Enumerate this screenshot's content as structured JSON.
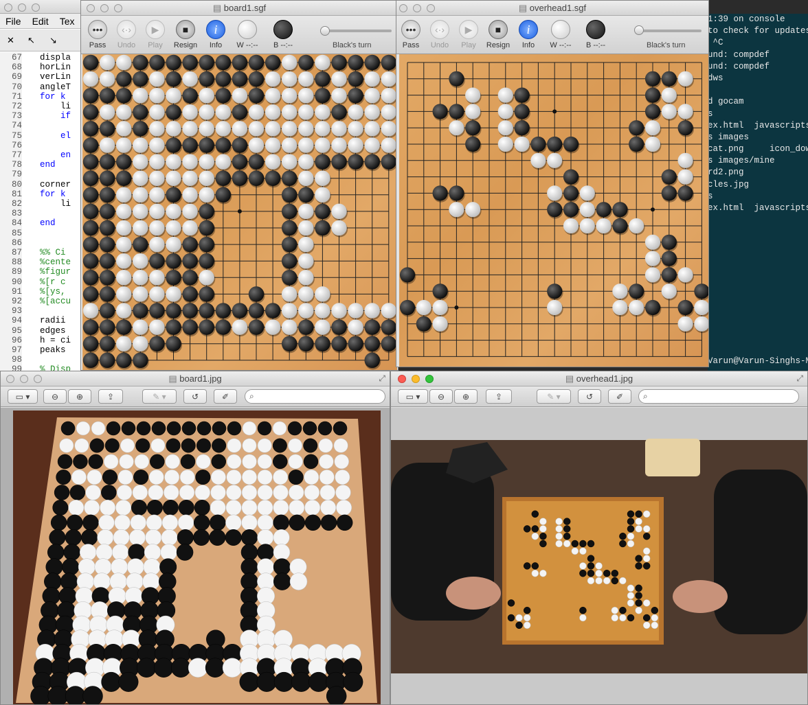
{
  "editor": {
    "menu": [
      "File",
      "Edit",
      "Tex"
    ],
    "lines": [
      {
        "n": "67",
        "t": "displa",
        "c": ""
      },
      {
        "n": "68",
        "t": "horLin",
        "c": ""
      },
      {
        "n": "69",
        "t": "verLin",
        "c": ""
      },
      {
        "n": "70",
        "t": "angleT",
        "c": ""
      },
      {
        "n": "71",
        "t": "for k",
        "c": "kw"
      },
      {
        "n": "72",
        "t": "    li",
        "c": ""
      },
      {
        "n": "73",
        "t": "    if",
        "c": "kw"
      },
      {
        "n": "74",
        "t": "",
        "c": ""
      },
      {
        "n": "75",
        "t": "    el",
        "c": "kw"
      },
      {
        "n": "76",
        "t": "",
        "c": ""
      },
      {
        "n": "77",
        "t": "    en",
        "c": "kw"
      },
      {
        "n": "78",
        "t": "end",
        "c": "kw"
      },
      {
        "n": "79",
        "t": "",
        "c": ""
      },
      {
        "n": "80",
        "t": "corner",
        "c": ""
      },
      {
        "n": "81",
        "t": "for k",
        "c": "kw"
      },
      {
        "n": "82",
        "t": "    li",
        "c": ""
      },
      {
        "n": "83",
        "t": "",
        "c": ""
      },
      {
        "n": "84",
        "t": "end",
        "c": "kw"
      },
      {
        "n": "85",
        "t": "",
        "c": ""
      },
      {
        "n": "86",
        "t": "",
        "c": ""
      },
      {
        "n": "87",
        "t": "%% Ci",
        "c": "cm"
      },
      {
        "n": "88",
        "t": "%cente",
        "c": "cm"
      },
      {
        "n": "89",
        "t": "%figur",
        "c": "cm"
      },
      {
        "n": "90",
        "t": "%[r c",
        "c": "cm"
      },
      {
        "n": "91",
        "t": "%[ys,",
        "c": "cm"
      },
      {
        "n": "92",
        "t": "%[accu",
        "c": "cm"
      },
      {
        "n": "93",
        "t": "",
        "c": ""
      },
      {
        "n": "94",
        "t": "radii",
        "c": ""
      },
      {
        "n": "95",
        "t": "edges",
        "c": ""
      },
      {
        "n": "96",
        "t": "h = ci",
        "c": ""
      },
      {
        "n": "97",
        "t": "peaks",
        "c": ""
      },
      {
        "n": "98",
        "t": "",
        "c": ""
      },
      {
        "n": "99",
        "t": "% Disp",
        "c": "cm"
      }
    ]
  },
  "terminal": {
    "lines": [
      "1:39 on console",
      "to check for updates?",
      " ^C",
      "und: compdef",
      "und: compdef",
      "dws",
      "",
      "d gocam",
      "s",
      "ex.html  javascripts",
      "s images",
      "cat.png     icon_dow",
      "s images/mine",
      "rd2.png",
      "cles.jpg",
      "s",
      "ex.html  javascripts",
      "",
      "",
      "",
      "",
      "",
      "",
      "",
      "",
      "",
      "",
      "",
      "",
      "Varun@Varun-Singhs-M"
    ]
  },
  "board1_sgf": {
    "title": "board1.sgf",
    "buttons": {
      "pass": "Pass",
      "undo": "Undo",
      "play": "Play",
      "resign": "Resign",
      "info": "Info"
    },
    "w_label": "W --:--",
    "b_label": "B --:--",
    "turn": "Black's turn",
    "rows": [
      "BWWBBBBBBBBBWBWBBBB",
      "WWBBWBWBBBBWWWBWBWW",
      "BBBWWWBWBWBWWWBWBWW",
      "BWWBWBWWWBWWWWWBWWW",
      "BBWBWWWWWWWWWWWWWWW",
      "BWWWWBBBBBWWWWWWWWW",
      "BBBWWWWWWBBWWWBBBBB",
      "BBBWWWWWBBBBBWW....",
      "BBWWWBWWB...BBW....",
      "BBWWWWWB....BWBW...",
      "BBWWWWWB....BWBW...",
      "BBWBWWBB....BW.....",
      "BBWWBBBB....BW.....",
      "BBWWWBBW....BW.....",
      "BBWWWWBB..B.WWW....",
      "WBWBBBBBBBBBWWWWWWW",
      "BBBWWBBBBWBWWBWBWBB",
      "BBWWBB......BBBBBBB",
      "BBBB.............B."
    ]
  },
  "overhead1_sgf": {
    "title": "overhead1.sgf",
    "buttons": {
      "pass": "Pass",
      "undo": "Undo",
      "play": "Play",
      "resign": "Resign",
      "info": "Info"
    },
    "w_label": "W --:--",
    "b_label": "B --:--",
    "turn": "Black's turn",
    "rows": [
      "...................",
      "...B...........BBW.",
      "....W.WB.......BW..",
      "..BBW.WB.......BWW.",
      "...WB.WB......BW.B.",
      "....B.WWBBB...BW...",
      "........WW.......W.",
      "..........B.....BW.",
      "..BB.....WBW....BB.",
      "...WW....BBWBB.....",
      "..........WWWBW....",
      "...............WB..",
      "...............WB..",
      "B..............WBW.",
      "..B......B...WB.W.B",
      "BWW......W...WWB.BW",
      ".BW..............WWW",
      "...................",
      "..................."
    ]
  },
  "board1_jpg": {
    "title": "board1.jpg"
  },
  "overhead1_jpg": {
    "title": "overhead1.jpg"
  }
}
